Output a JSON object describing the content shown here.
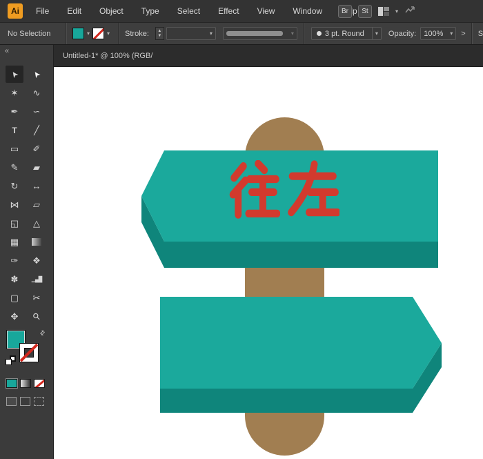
{
  "menubar": {
    "logo_text": "Ai",
    "items": [
      "File",
      "Edit",
      "Object",
      "Type",
      "Select",
      "Effect",
      "View",
      "Window",
      "Help"
    ],
    "bridge_label": "Br",
    "stock_label": "St"
  },
  "controlbar": {
    "selection_status": "No Selection",
    "stroke_label": "Stroke:",
    "brush_name": "3 pt. Round",
    "opacity_label": "Opacity:",
    "opacity_value": "100%",
    "overflow_chevron": ">",
    "style_partial": "S"
  },
  "tabbar": {
    "title": "Untitled-1* @ 100% (RGB/"
  },
  "toolbar": {
    "collapse_glyph": "«",
    "tools": [
      {
        "name": "selection",
        "glyph": "➤",
        "active": true
      },
      {
        "name": "direct-selection",
        "glyph": "➤"
      },
      {
        "name": "magic-wand",
        "glyph": "✶"
      },
      {
        "name": "lasso",
        "glyph": "∿"
      },
      {
        "name": "pen",
        "glyph": "✒"
      },
      {
        "name": "curvature",
        "glyph": "∽"
      },
      {
        "name": "type",
        "glyph": "T"
      },
      {
        "name": "line-segment",
        "glyph": "╱"
      },
      {
        "name": "rectangle",
        "glyph": "▭"
      },
      {
        "name": "paintbrush",
        "glyph": "✐"
      },
      {
        "name": "pencil",
        "glyph": "✎"
      },
      {
        "name": "eraser",
        "glyph": "▰"
      },
      {
        "name": "rotate",
        "glyph": "↻"
      },
      {
        "name": "scale",
        "glyph": "↔"
      },
      {
        "name": "width",
        "glyph": "⋈"
      },
      {
        "name": "free-transform",
        "glyph": "▱"
      },
      {
        "name": "shape-builder",
        "glyph": "◱"
      },
      {
        "name": "perspective-grid",
        "glyph": "△"
      },
      {
        "name": "mesh",
        "glyph": "▦"
      },
      {
        "name": "gradient",
        "glyph": "■"
      },
      {
        "name": "eyedropper",
        "glyph": "✑"
      },
      {
        "name": "blend",
        "glyph": "❖"
      },
      {
        "name": "symbol-sprayer",
        "glyph": "✽"
      },
      {
        "name": "column-graph",
        "glyph": "▁▄█"
      },
      {
        "name": "artboard",
        "glyph": "▢"
      },
      {
        "name": "slice",
        "glyph": "✂"
      },
      {
        "name": "hand",
        "glyph": "✥"
      },
      {
        "name": "zoom",
        "glyph": "⚲"
      }
    ]
  },
  "canvas": {
    "sign_text": "往左"
  },
  "colors": {
    "fill_teal": "#18A79B",
    "sign_teal": "#1BA99C",
    "sign_teal_dark": "#0F857B",
    "post_brown": "#A17E51",
    "text_red": "#D23A2E",
    "logo_orange": "#EF9C21",
    "none_red": "#D3281E"
  }
}
